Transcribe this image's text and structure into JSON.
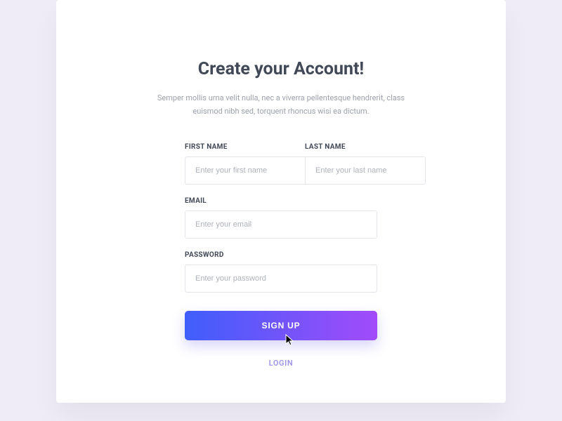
{
  "header": {
    "title": "Create your Account!",
    "subtitle": "Semper mollis urna velit nulla, nec a viverra pellentesque hendrerit, class euismod nibh sed, torquent rhoncus wisi ea dictum."
  },
  "form": {
    "first_name": {
      "label": "FIRST NAME",
      "placeholder": "Enter your first name",
      "value": ""
    },
    "last_name": {
      "label": "LAST NAME",
      "placeholder": "Enter your last name",
      "value": ""
    },
    "email": {
      "label": "EMAIL",
      "placeholder": "Enter your email",
      "value": ""
    },
    "password": {
      "label": "PASSWORD",
      "placeholder": "Enter your password",
      "value": ""
    },
    "submit_label": "SIGN UP",
    "login_label": "LOGIN"
  },
  "colors": {
    "background": "#efecf8",
    "card": "#ffffff",
    "title": "#414856",
    "subtitle": "#9ba0ab",
    "border": "#e3e5ea",
    "placeholder": "#adb1ba",
    "gradient_start": "#3f5efb",
    "gradient_end": "#a24bfa",
    "link": "#9c94e6"
  }
}
